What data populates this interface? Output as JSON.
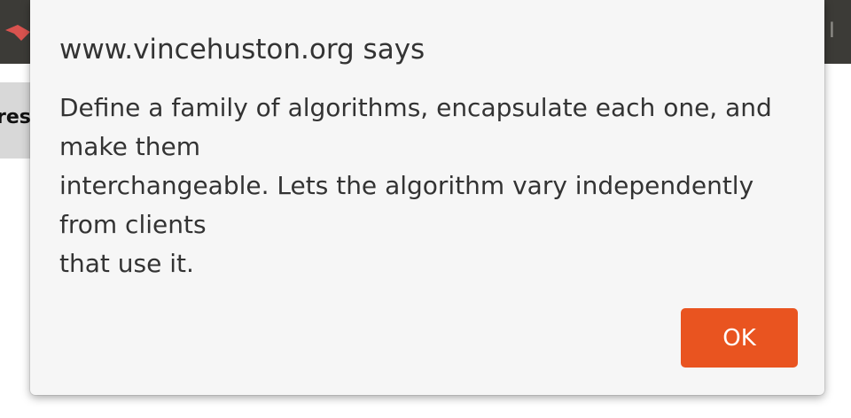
{
  "browser": {
    "logo_icon": "ubuntu-red-logo-icon",
    "right_glyph": "I"
  },
  "page": {
    "button_fragment": "res"
  },
  "dialog": {
    "title": "www.vincehuston.org says",
    "message_lines": [
      "Define a family of algorithms, encapsulate each one, and",
      "make them",
      "interchangeable.  Lets the algorithm vary independently",
      "from clients",
      "that use it."
    ],
    "ok_label": "OK"
  },
  "colors": {
    "accent": "#e95420",
    "topbar": "#3c3b37",
    "dialog_bg": "#f6f6f6",
    "text": "#333333"
  }
}
